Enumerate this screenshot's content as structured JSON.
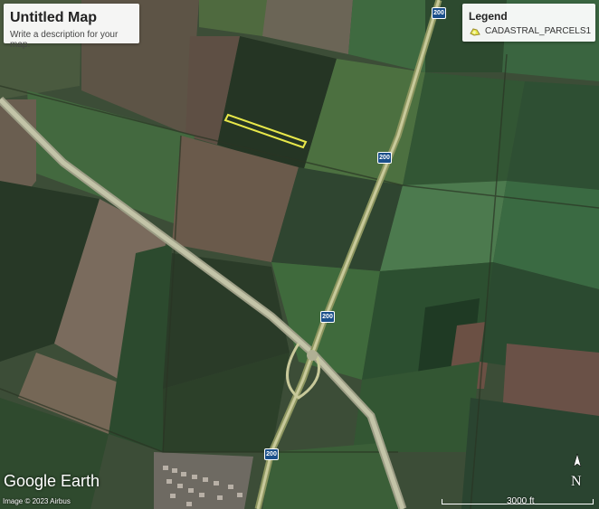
{
  "map": {
    "title": "Untitled Map",
    "description": "Write a description for your map."
  },
  "legend": {
    "title": "Legend",
    "items": [
      {
        "label": "CADASTRAL_PARCELS1"
      }
    ]
  },
  "overlay": {
    "logo": "Google Earth",
    "attribution": "Image © 2023 Airbus",
    "north_label": "N",
    "scale_label": "3000 ft"
  },
  "road_shields": [
    "200",
    "200",
    "200",
    "200"
  ],
  "colors": {
    "parcel_outline": "#e8e84a",
    "highway": "#c8c99a",
    "road_shield": "#1b4f8a"
  }
}
